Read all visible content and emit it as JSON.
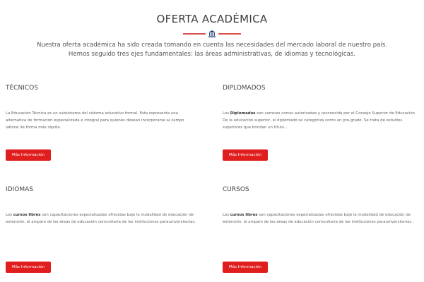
{
  "header": {
    "title": "OFERTA ACADÉMICA",
    "intro_line1": "Nuestra oferta académica ha sido creada tomando en cuenta las necesidades del mercado laboral de nuestro país.",
    "intro_line2": "Hemos seguido tres ejes fundamentales: las áreas administrativas, de idiomas y tecnológicas.",
    "accent_color": "#d9534f"
  },
  "cards": {
    "tecnicos": {
      "title": "TÉCNICOS",
      "text": "La Educación Técnica es un subsistema del sistema educativo formal. Esta representa una alternativa de formación especializada e integral para quienes desean incorporarse al campo laboral de forma más rápida.",
      "button": "Más Información"
    },
    "diplomados": {
      "title": "DIPLOMADOS",
      "text_prefix": "Los ",
      "text_bold": "Diplomados",
      "text_rest": " son carreras cortas autorizadas y reconocida por el Consejo Superior de Educación. De la educación superior, el diplomado se categoriza como un pre-grado. Se trata de estudios superiores que brindan un título...",
      "button": "Más Información"
    },
    "idiomas": {
      "title": "IDIOMAS",
      "text_prefix": "Los ",
      "text_bold": "cursos libres",
      "text_rest": " son capacitaciones especializadas ofrecidas bajo la modalidad de educación de extensión, al amparo de las áreas de educación comunitaria de las instituciones parauniversitarias.",
      "button": "Más Información"
    },
    "cursos": {
      "title": "CURSOS",
      "text_prefix": "Los ",
      "text_bold": "cursos libres",
      "text_rest": " son capacitaciones especializadas ofrecidas bajo la modalidad de educación de extensión, al amparo de las áreas de educación comunitaria de las instituciones parauniversitarias.",
      "button": "Más Información"
    }
  },
  "button_color": "#e01e1e",
  "icons": {
    "title_divider_icon": "university-building-icon"
  }
}
